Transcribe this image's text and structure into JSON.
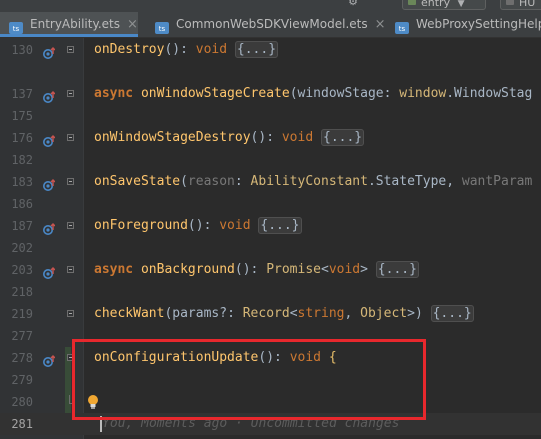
{
  "toolbar": {
    "run_config": "entry",
    "device": "HU"
  },
  "tabs": [
    {
      "label": "EntryAbility.ets",
      "active": true,
      "closable": true
    },
    {
      "label": "CommonWebSDKViewModel.ets",
      "active": false,
      "closable": true
    },
    {
      "label": "WebProxySettingHelpe",
      "active": false,
      "closable": false
    }
  ],
  "close_glyph": "×",
  "lines": [
    {
      "number": "130",
      "implements": true,
      "fold": "collapsed",
      "tokens": [
        {
          "c": "fn",
          "t": "onDestroy"
        },
        {
          "c": "txt",
          "t": "(): "
        },
        {
          "c": "type",
          "t": "void"
        },
        {
          "c": "txt",
          "t": " "
        },
        {
          "c": "fold",
          "t": "{...}"
        }
      ]
    },
    {
      "number": "",
      "tokens": []
    },
    {
      "number": "137",
      "implements": true,
      "fold": "collapsed",
      "tokens": [
        {
          "c": "kw",
          "t": "async"
        },
        {
          "c": "txt",
          "t": " "
        },
        {
          "c": "fn",
          "t": "onWindowStageCreate"
        },
        {
          "c": "txt",
          "t": "(windowStage: "
        },
        {
          "c": "ns",
          "t": "window"
        },
        {
          "c": "txt",
          "t": ".WindowStag"
        }
      ]
    },
    {
      "number": "175",
      "tokens": []
    },
    {
      "number": "176",
      "implements": true,
      "fold": "collapsed",
      "tokens": [
        {
          "c": "fn",
          "t": "onWindowStageDestroy"
        },
        {
          "c": "txt",
          "t": "(): "
        },
        {
          "c": "type",
          "t": "void"
        },
        {
          "c": "txt",
          "t": " "
        },
        {
          "c": "fold",
          "t": "{...}"
        }
      ]
    },
    {
      "number": "182",
      "tokens": []
    },
    {
      "number": "183",
      "implements": true,
      "fold": "collapsed",
      "tokens": [
        {
          "c": "fn",
          "t": "onSaveState"
        },
        {
          "c": "txt",
          "t": "("
        },
        {
          "c": "grey",
          "t": "reason"
        },
        {
          "c": "txt",
          "t": ": "
        },
        {
          "c": "ns",
          "t": "AbilityConstant"
        },
        {
          "c": "txt",
          "t": ".StateType, "
        },
        {
          "c": "grey",
          "t": "wantParam"
        }
      ]
    },
    {
      "number": "186",
      "tokens": []
    },
    {
      "number": "187",
      "implements": true,
      "fold": "collapsed",
      "tokens": [
        {
          "c": "fn",
          "t": "onForeground"
        },
        {
          "c": "txt",
          "t": "(): "
        },
        {
          "c": "type",
          "t": "void"
        },
        {
          "c": "txt",
          "t": " "
        },
        {
          "c": "fold",
          "t": "{...}"
        }
      ]
    },
    {
      "number": "202",
      "tokens": []
    },
    {
      "number": "203",
      "implements": true,
      "fold": "collapsed",
      "tokens": [
        {
          "c": "kw",
          "t": "async"
        },
        {
          "c": "txt",
          "t": " "
        },
        {
          "c": "fn",
          "t": "onBackground"
        },
        {
          "c": "txt",
          "t": "(): "
        },
        {
          "c": "ns",
          "t": "Promise"
        },
        {
          "c": "txt",
          "t": "<"
        },
        {
          "c": "type",
          "t": "void"
        },
        {
          "c": "txt",
          "t": "> "
        },
        {
          "c": "fold",
          "t": "{...}"
        }
      ]
    },
    {
      "number": "218",
      "tokens": []
    },
    {
      "number": "219",
      "implements": false,
      "fold": "collapsed",
      "tokens": [
        {
          "c": "fn",
          "t": "checkWant"
        },
        {
          "c": "txt",
          "t": "(params?: "
        },
        {
          "c": "ns",
          "t": "Record"
        },
        {
          "c": "txt",
          "t": "<"
        },
        {
          "c": "type",
          "t": "string"
        },
        {
          "c": "txt",
          "t": ", "
        },
        {
          "c": "ns",
          "t": "Object"
        },
        {
          "c": "txt",
          "t": ">) "
        },
        {
          "c": "fold",
          "t": "{...}"
        }
      ]
    },
    {
      "number": "277",
      "tokens": []
    },
    {
      "number": "278",
      "implements": true,
      "fold": "open",
      "tokens": [
        {
          "c": "fn",
          "t": "onConfigurationUpdate"
        },
        {
          "c": "txt",
          "t": "(): "
        },
        {
          "c": "type",
          "t": "void"
        },
        {
          "c": "txt",
          "t": " "
        },
        {
          "c": "paren",
          "t": "{"
        }
      ]
    },
    {
      "number": "279",
      "tokens": []
    },
    {
      "number": "280",
      "bulb": true,
      "fold": "end",
      "tokens": []
    },
    {
      "number": "281",
      "current": true,
      "blame": "You, Moments ago · Uncommitted changes",
      "tokens": []
    }
  ],
  "colors": {
    "highlight_box": "#e8282d",
    "modified_marker": "#384c38"
  }
}
